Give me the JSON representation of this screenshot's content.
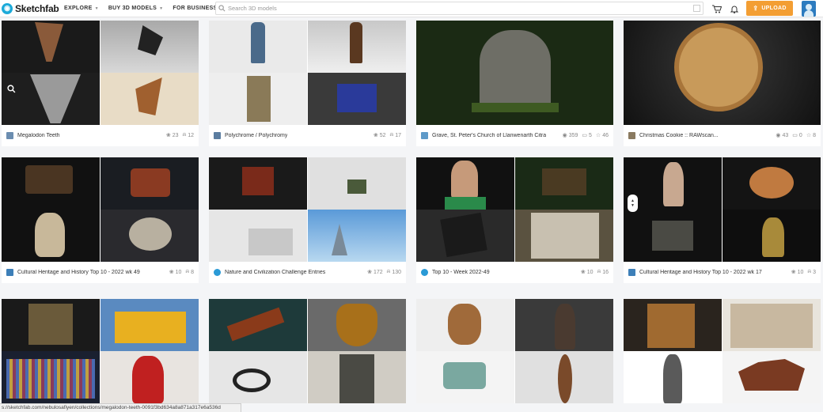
{
  "header": {
    "brand": "Sketchfab",
    "nav": [
      {
        "label": "EXPLORE"
      },
      {
        "label": "BUY 3D MODELS"
      },
      {
        "label": "FOR BUSINESS"
      }
    ],
    "search_placeholder": "Search 3D models",
    "upload_label": "UPLOAD"
  },
  "cards": [
    {
      "title": "Megalodon Teeth",
      "stats": [
        "23",
        "12"
      ],
      "avatar_color": "#6b8db0"
    },
    {
      "title": "Polychrome / Polychromy",
      "stats": [
        "52",
        "17"
      ],
      "avatar_color": "#5b7da0"
    },
    {
      "title": "Grave, St. Peter's Church of Llanwenarth Citra",
      "stats": [
        "359",
        "5",
        "46"
      ],
      "avatar_color": "#5e9ac8"
    },
    {
      "title": "Christmas Cookie :: RAWscan...",
      "stats": [
        "43",
        "0",
        "8"
      ],
      "avatar_color": "#8a7a60"
    },
    {
      "title": "Cultural Heritage and History Top 10 - 2022 wk 49",
      "stats": [
        "10",
        "8"
      ],
      "avatar_color": "#3d7fb8"
    },
    {
      "title": "Nature and Civilization Challenge Entries",
      "stats": [
        "172",
        "130"
      ],
      "avatar_color": "#2a9ad6"
    },
    {
      "title": "Top 10 - Week 2022-49",
      "stats": [
        "10",
        "16"
      ],
      "avatar_color": "#2a9ad6"
    },
    {
      "title": "Cultural Heritage and History Top 10 - 2022 wk 17",
      "stats": [
        "10",
        "3"
      ],
      "avatar_color": "#3d7fb8"
    }
  ],
  "status_url": "s://sketchfab.com/nebulosafiyen/collections/megalodon-teeth-0091f3bd634a8a871a317e6a536d"
}
